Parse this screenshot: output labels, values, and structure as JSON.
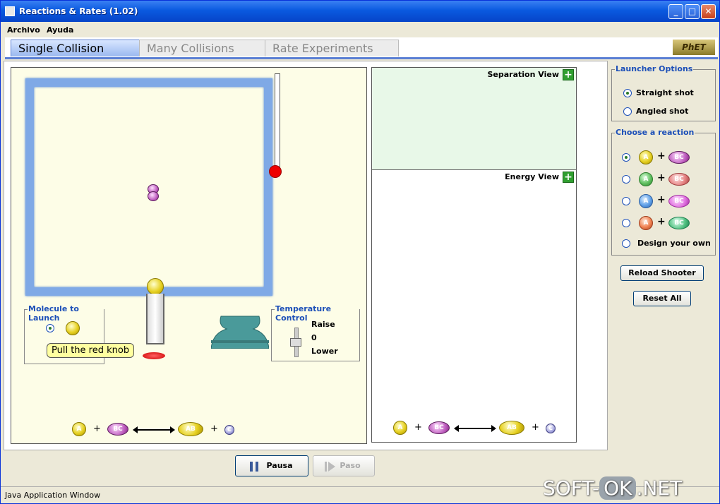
{
  "window": {
    "title": "Reactions & Rates (1.02)",
    "minimize": "_",
    "maximize": "□",
    "close": "✕"
  },
  "menu": {
    "file": "Archivo",
    "help": "Ayuda"
  },
  "tabs": [
    {
      "label": "Single Collision",
      "active": true
    },
    {
      "label": "Many Collisions",
      "active": false
    },
    {
      "label": "Rate Experiments",
      "active": false
    }
  ],
  "logo": "PhET",
  "sim": {
    "molecule_to_launch": {
      "legend": "Molecule to Launch",
      "selected": "A"
    },
    "tooltip": "Pull the red knob",
    "temperature_control": {
      "legend": "Temperature Control",
      "raise": "Raise",
      "value": "0",
      "lower": "Lower"
    },
    "equation": {
      "a": "A",
      "plus1": "+",
      "bc": "BC",
      "ab": "AB",
      "plus2": "+",
      "c": "C"
    }
  },
  "views": {
    "separation": {
      "label": "Separation View",
      "plus": "+"
    },
    "energy": {
      "label": "Energy View",
      "plus": "+"
    },
    "equation": {
      "a": "A",
      "plus1": "+",
      "bc": "BC",
      "ab": "AB",
      "plus2": "+",
      "c": "C"
    }
  },
  "launcher_options": {
    "legend": "Launcher Options",
    "options": [
      {
        "label": "Straight shot",
        "selected": true
      },
      {
        "label": "Angled shot",
        "selected": false
      }
    ]
  },
  "choose_reaction": {
    "legend": "Choose a reaction",
    "reactions": [
      {
        "a": "A",
        "plus": "+",
        "bc": "BC",
        "selected": true,
        "color_a": "#e6d020",
        "color_bc": "#c060c0"
      },
      {
        "a": "A",
        "plus": "+",
        "bc": "BC",
        "selected": false,
        "color_a": "#5fbf5f",
        "color_bc": "#e58080"
      },
      {
        "a": "A",
        "plus": "+",
        "bc": "BC",
        "selected": false,
        "color_a": "#5fa0e8",
        "color_bc": "#e070e0"
      },
      {
        "a": "A",
        "plus": "+",
        "bc": "BC",
        "selected": false,
        "color_a": "#f08050",
        "color_bc": "#50c080"
      }
    ],
    "design_own": "Design your own"
  },
  "buttons": {
    "reload": "Reload Shooter",
    "reset": "Reset All",
    "pause": "Pausa",
    "step": "Paso"
  },
  "status": "Java Application Window",
  "watermark": {
    "left": "SOFT-",
    "ok": "OK",
    "right": ".NET"
  }
}
